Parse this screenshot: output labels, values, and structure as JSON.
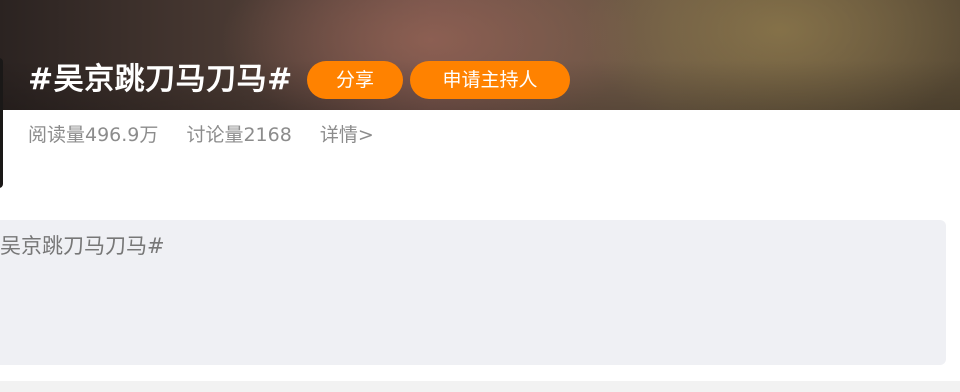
{
  "topic": {
    "title": "#吴京跳刀马刀马#"
  },
  "actions": {
    "share_label": "分享",
    "apply_host_label": "申请主持人"
  },
  "stats": {
    "reads": "阅读量496.9万",
    "discussions": "讨论量2168",
    "details": "详情>"
  },
  "composer": {
    "text": "吴京跳刀马刀马#"
  },
  "colors": {
    "accent": "#ff8200",
    "stats_text": "#8c8c8c",
    "composer_bg": "#eff0f4"
  }
}
